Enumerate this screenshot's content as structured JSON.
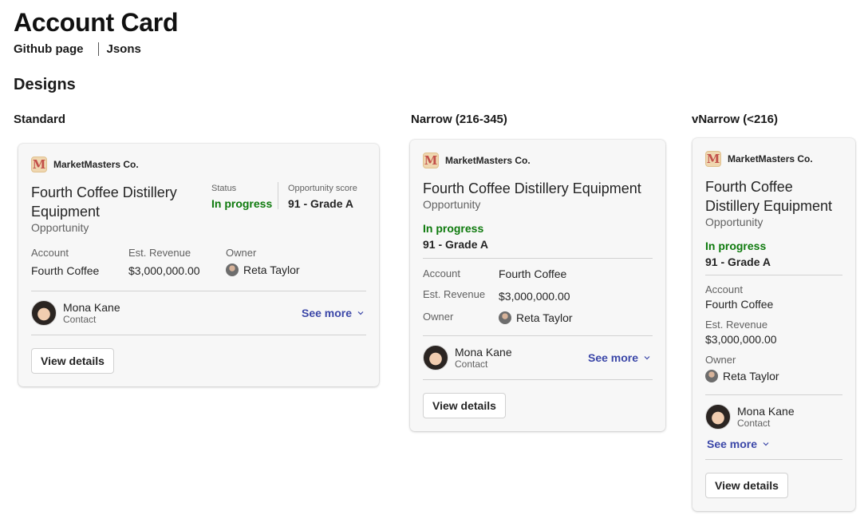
{
  "header": {
    "title": "Account Card",
    "links": [
      "Github page",
      "Jsons"
    ],
    "section": "Designs"
  },
  "columns": [
    "Standard",
    "Narrow (216-345)",
    "vNarrow (<216)"
  ],
  "card": {
    "company": "MarketMasters Co.",
    "logo_letter": "M",
    "title": "Fourth Coffee Distillery Equipment",
    "title_line1": "Fourth Coffee Distillery",
    "title_line2": "Equipment",
    "vnarrow_title_line1": "Fourth Coffee",
    "vnarrow_title_line2": "Distillery Equipment",
    "subtitle": "Opportunity",
    "status_label": "Status",
    "status_value": "In progress",
    "score_label": "Opportunity score",
    "score_value": "91 - Grade A",
    "account_label": "Account",
    "account_value": "Fourth Coffee",
    "revenue_label": "Est. Revenue",
    "revenue_value": "$3,000,000.00",
    "owner_label": "Owner",
    "owner_value": "Reta Taylor",
    "contact_name": "Mona Kane",
    "contact_role": "Contact",
    "see_more": "See more",
    "view_details": "View details"
  },
  "colors": {
    "status_green": "#0e7a0d",
    "link_blue": "#3b47a8"
  },
  "icons": [
    "company-logo-icon",
    "chevron-down-icon",
    "owner-avatar",
    "contact-avatar"
  ]
}
